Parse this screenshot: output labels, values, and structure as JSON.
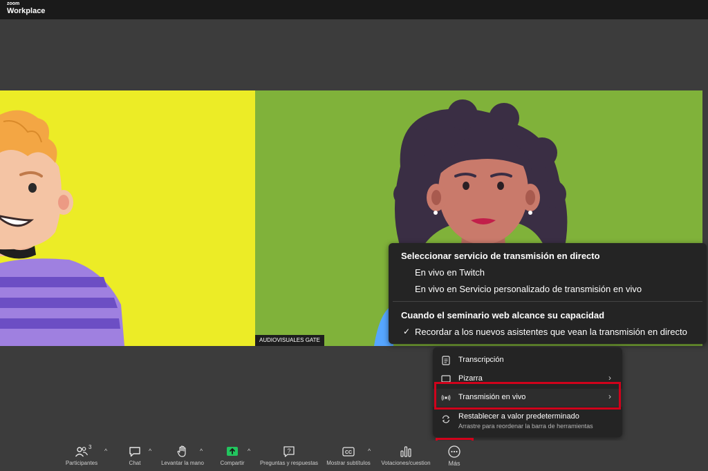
{
  "app": {
    "brand_top": "zoom",
    "brand_main": "Workplace"
  },
  "participant": {
    "name_tag": "AUDIOVISUALES GATE"
  },
  "livestream_submenu": {
    "header_select": "Seleccionar servicio de transmisión en directo",
    "option_twitch": "En vivo en Twitch",
    "option_custom": "En vivo en Servicio personalizado de transmisión en vivo",
    "header_capacity": "Cuando el seminario web alcance su capacidad",
    "check_mark": "✓",
    "option_remind": "Recordar a los nuevos asistentes que vean la transmisión en directo"
  },
  "more_menu": {
    "transcription": "Transcripción",
    "whiteboard": "Pizarra",
    "livestream": "Transmisión en vivo",
    "reset": "Restablecer a valor predeterminado",
    "reset_hint": "Arrastre para reordenar la barra de herramientas",
    "chevron": "›"
  },
  "toolbar": {
    "participants_label": "Participantes",
    "participants_count": "3",
    "chat_label": "Chat",
    "raise_hand_label": "Levantar la mano",
    "share_label": "Compartir",
    "qa_label": "Preguntas y respuestas",
    "captions_label": "Mostrar subtítulos",
    "polls_label": "Votaciones/cuestion",
    "more_label": "Más",
    "caret": "^"
  },
  "colors": {
    "left_bg": "#ecec26",
    "right_bg": "#80b23a",
    "highlight": "#d0021b",
    "share_green": "#22c55e"
  }
}
